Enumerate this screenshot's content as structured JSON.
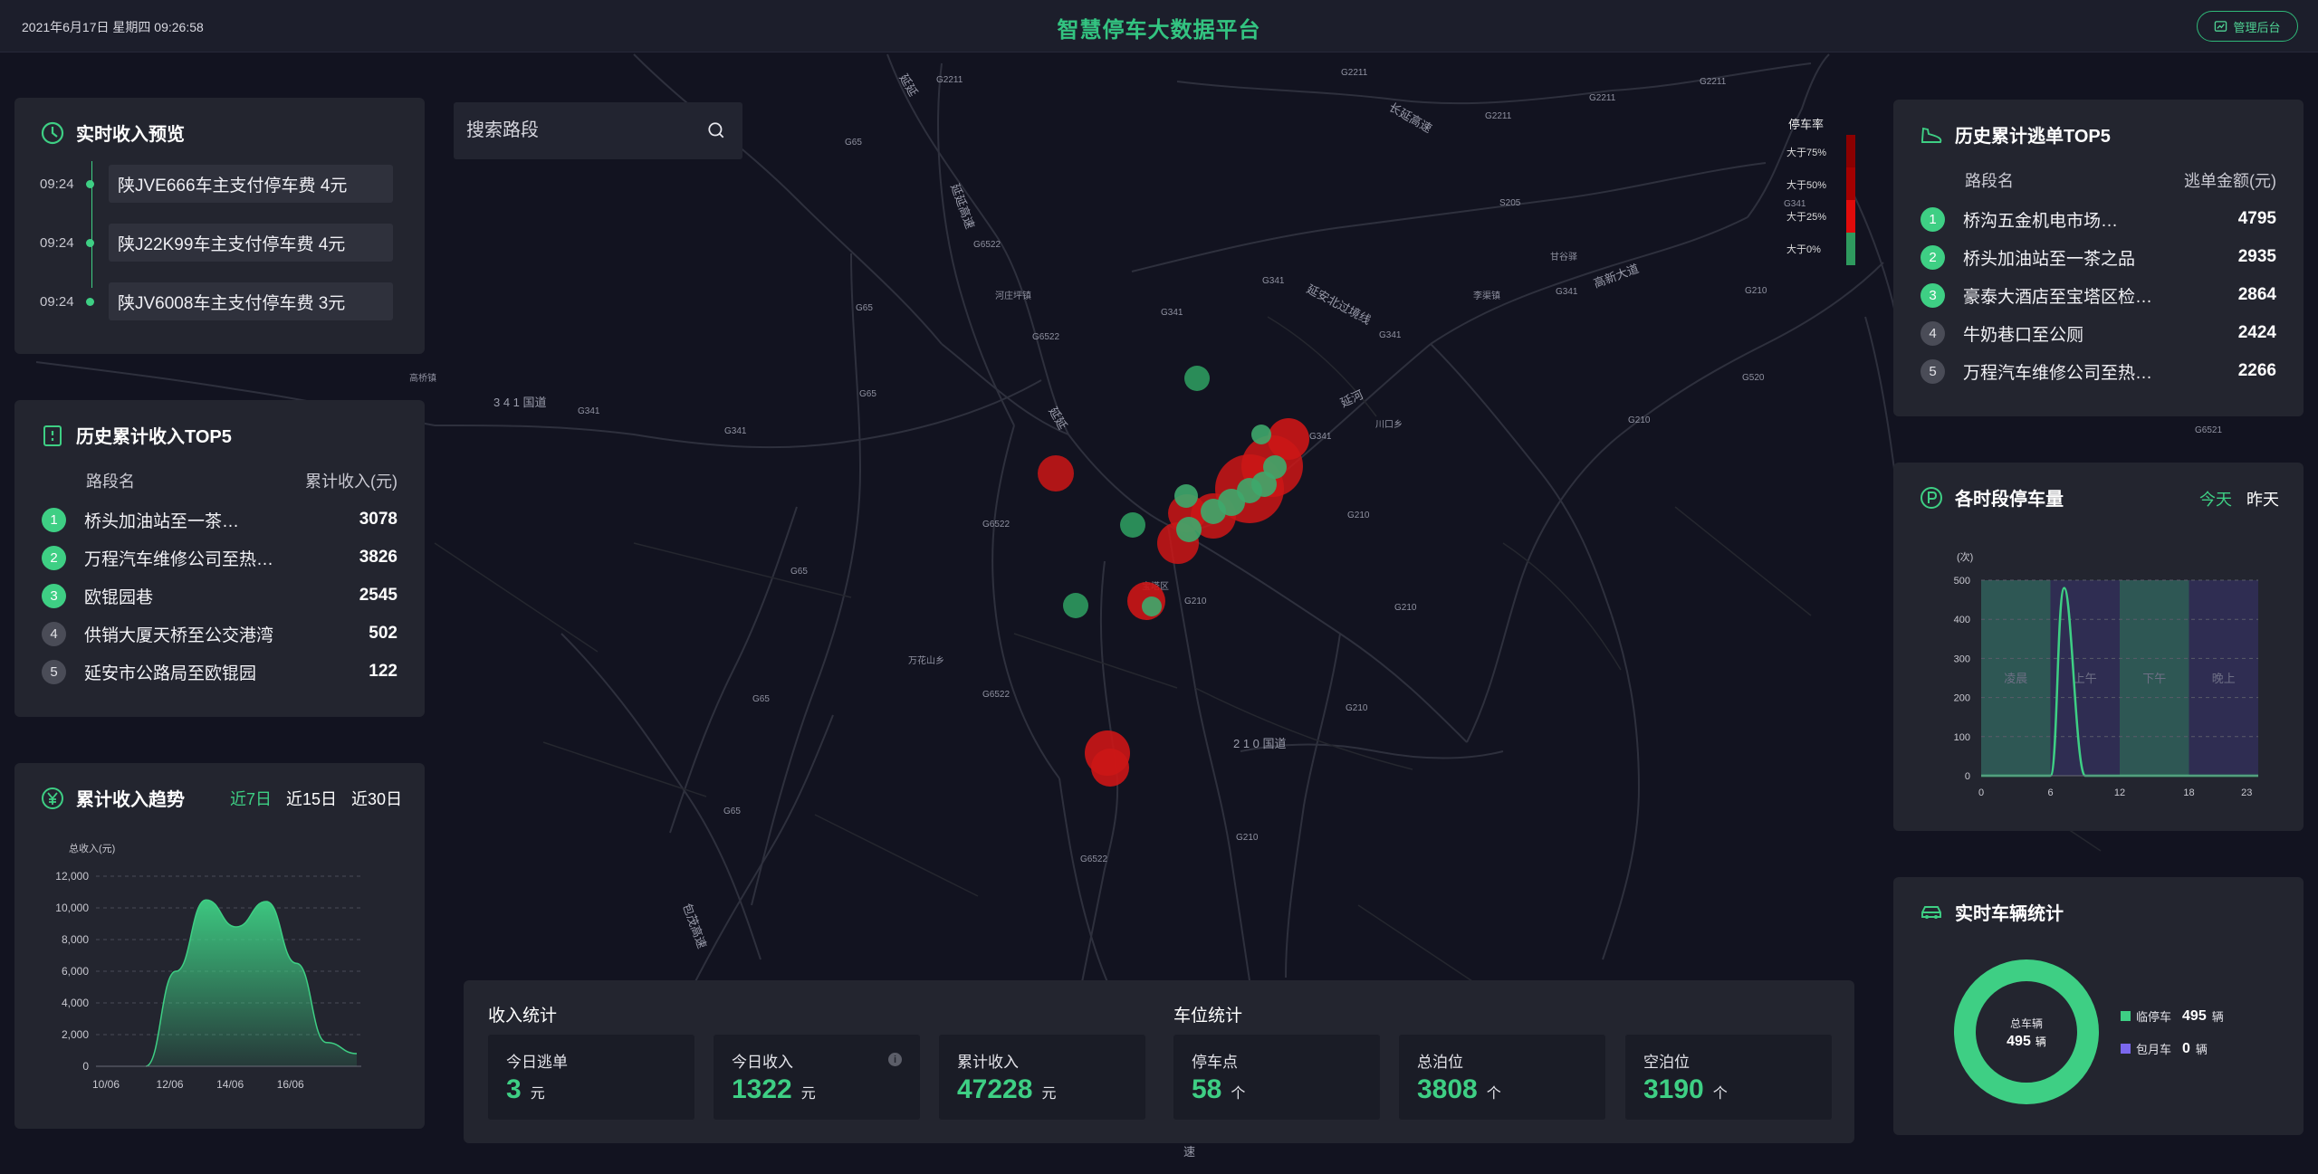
{
  "header": {
    "datetime": "2021年6月17日 星期四 09:26:58",
    "title": "智慧停车大数据平台",
    "admin_label": "管理后台"
  },
  "search": {
    "placeholder": "搜索路段"
  },
  "map": {
    "legend_title": "停车率",
    "legend_items": [
      "大于75%",
      "大于50%",
      "大于25%",
      "大于0%"
    ],
    "road_labels": [
      "G2211",
      "G2211",
      "G2211",
      "G2211",
      "G2211",
      "G65",
      "G65",
      "G65",
      "G65",
      "G65",
      "G65",
      "G6522",
      "G6522",
      "G6522",
      "G6522",
      "G6522",
      "G341",
      "G341",
      "G341",
      "G341",
      "G341",
      "G341",
      "G210",
      "G210",
      "G210",
      "G210",
      "G210",
      "G210",
      "G210",
      "G520",
      "G6521",
      "S205",
      "长延高速",
      "延延高速",
      "延安北过境线",
      "延河",
      "高新大道",
      "包茂高速",
      "延延",
      "3 4 1 国道",
      "2 1 0 国道",
      "河庄坪镇",
      "李渠镇",
      "川口乡",
      "万花山乡",
      "高桥镇",
      "宝塔区",
      "甘谷驿",
      "延安",
      "速"
    ]
  },
  "realtime": {
    "title": "实时收入预览",
    "items": [
      {
        "time": "09:24",
        "text": "陕JVE666车主支付停车费 4元"
      },
      {
        "time": "09:24",
        "text": "陕J22K99车主支付停车费 4元"
      },
      {
        "time": "09:24",
        "text": "陕JV6008车主支付停车费 3元"
      }
    ]
  },
  "income_top5": {
    "title": "历史累计收入TOP5",
    "col_name": "路段名",
    "col_value": "累计收入(元)",
    "rows": [
      {
        "rank": "1",
        "name": "桥头加油站至一茶…",
        "value": "3078"
      },
      {
        "rank": "2",
        "name": "万程汽车维修公司至热…",
        "value": "3826"
      },
      {
        "rank": "3",
        "name": "欧锟园巷",
        "value": "2545"
      },
      {
        "rank": "4",
        "name": "供销大厦天桥至公交港湾",
        "value": "502"
      },
      {
        "rank": "5",
        "name": "延安市公路局至欧锟园",
        "value": "122"
      }
    ]
  },
  "trend": {
    "title": "累计收入趋势",
    "tabs": [
      "近7日",
      "近15日",
      "近30日"
    ],
    "ylabel": "总收入(元)",
    "yticks": [
      "12,000",
      "10,000",
      "8,000",
      "6,000",
      "4,000",
      "2,000",
      "0"
    ],
    "xticks": [
      "10/06",
      "12/06",
      "14/06",
      "16/06"
    ]
  },
  "escape_top5": {
    "title": "历史累计逃单TOP5",
    "col_name": "路段名",
    "col_value": "逃单金额(元)",
    "rows": [
      {
        "rank": "1",
        "name": "桥沟五金机电市场…",
        "value": "4795"
      },
      {
        "rank": "2",
        "name": "桥头加油站至一茶之品",
        "value": "2935"
      },
      {
        "rank": "3",
        "name": "豪泰大酒店至宝塔区检…",
        "value": "2864"
      },
      {
        "rank": "4",
        "name": "牛奶巷口至公厕",
        "value": "2424"
      },
      {
        "rank": "5",
        "name": "万程汽车维修公司至热…",
        "value": "2266"
      }
    ]
  },
  "period": {
    "title": "各时段停车量",
    "tabs": [
      "今天",
      "昨天"
    ],
    "ylabel": "(次)",
    "yticks": [
      "500",
      "400",
      "300",
      "200",
      "100",
      "0"
    ],
    "xticks": [
      "0",
      "6",
      "12",
      "18",
      "23"
    ],
    "bands": [
      "凌晨",
      "上午",
      "下午",
      "晚上"
    ]
  },
  "vehicles": {
    "title": "实时车辆统计",
    "center_label": "总车辆",
    "center_value": "495",
    "center_unit": "辆",
    "legend": [
      {
        "name": "临停车",
        "value": "495",
        "unit": "辆",
        "color": "#3ecf84"
      },
      {
        "name": "包月车",
        "value": "0",
        "unit": "辆",
        "color": "#7b68ee"
      }
    ]
  },
  "stats": {
    "income_title": "收入统计",
    "space_title": "车位统计",
    "boxes": [
      {
        "label": "今日逃单",
        "value": "3",
        "unit": "元"
      },
      {
        "label": "今日收入",
        "value": "1322",
        "unit": "元"
      },
      {
        "label": "累计收入",
        "value": "47228",
        "unit": "元"
      },
      {
        "label": "停车点",
        "value": "58",
        "unit": "个"
      },
      {
        "label": "总泊位",
        "value": "3808",
        "unit": "个"
      },
      {
        "label": "空泊位",
        "value": "3190",
        "unit": "个"
      }
    ]
  },
  "chart_data": [
    {
      "type": "area",
      "title": "累计收入趋势",
      "ylabel": "总收入(元)",
      "x": [
        "10/06",
        "11/06",
        "12/06",
        "13/06",
        "14/06",
        "15/06",
        "16/06",
        "17/06"
      ],
      "values": [
        0,
        6000,
        10500,
        8800,
        10400,
        6500,
        1500,
        800
      ],
      "ylim": [
        0,
        12000
      ]
    },
    {
      "type": "line",
      "title": "各时段停车量",
      "ylabel": "(次)",
      "x": [
        0,
        6,
        7,
        8,
        9,
        12,
        18,
        23
      ],
      "values": [
        0,
        0,
        480,
        350,
        0,
        0,
        0,
        0
      ],
      "ylim": [
        0,
        500
      ]
    },
    {
      "type": "pie",
      "title": "实时车辆统计",
      "categories": [
        "临停车",
        "包月车"
      ],
      "values": [
        495,
        0
      ]
    }
  ]
}
